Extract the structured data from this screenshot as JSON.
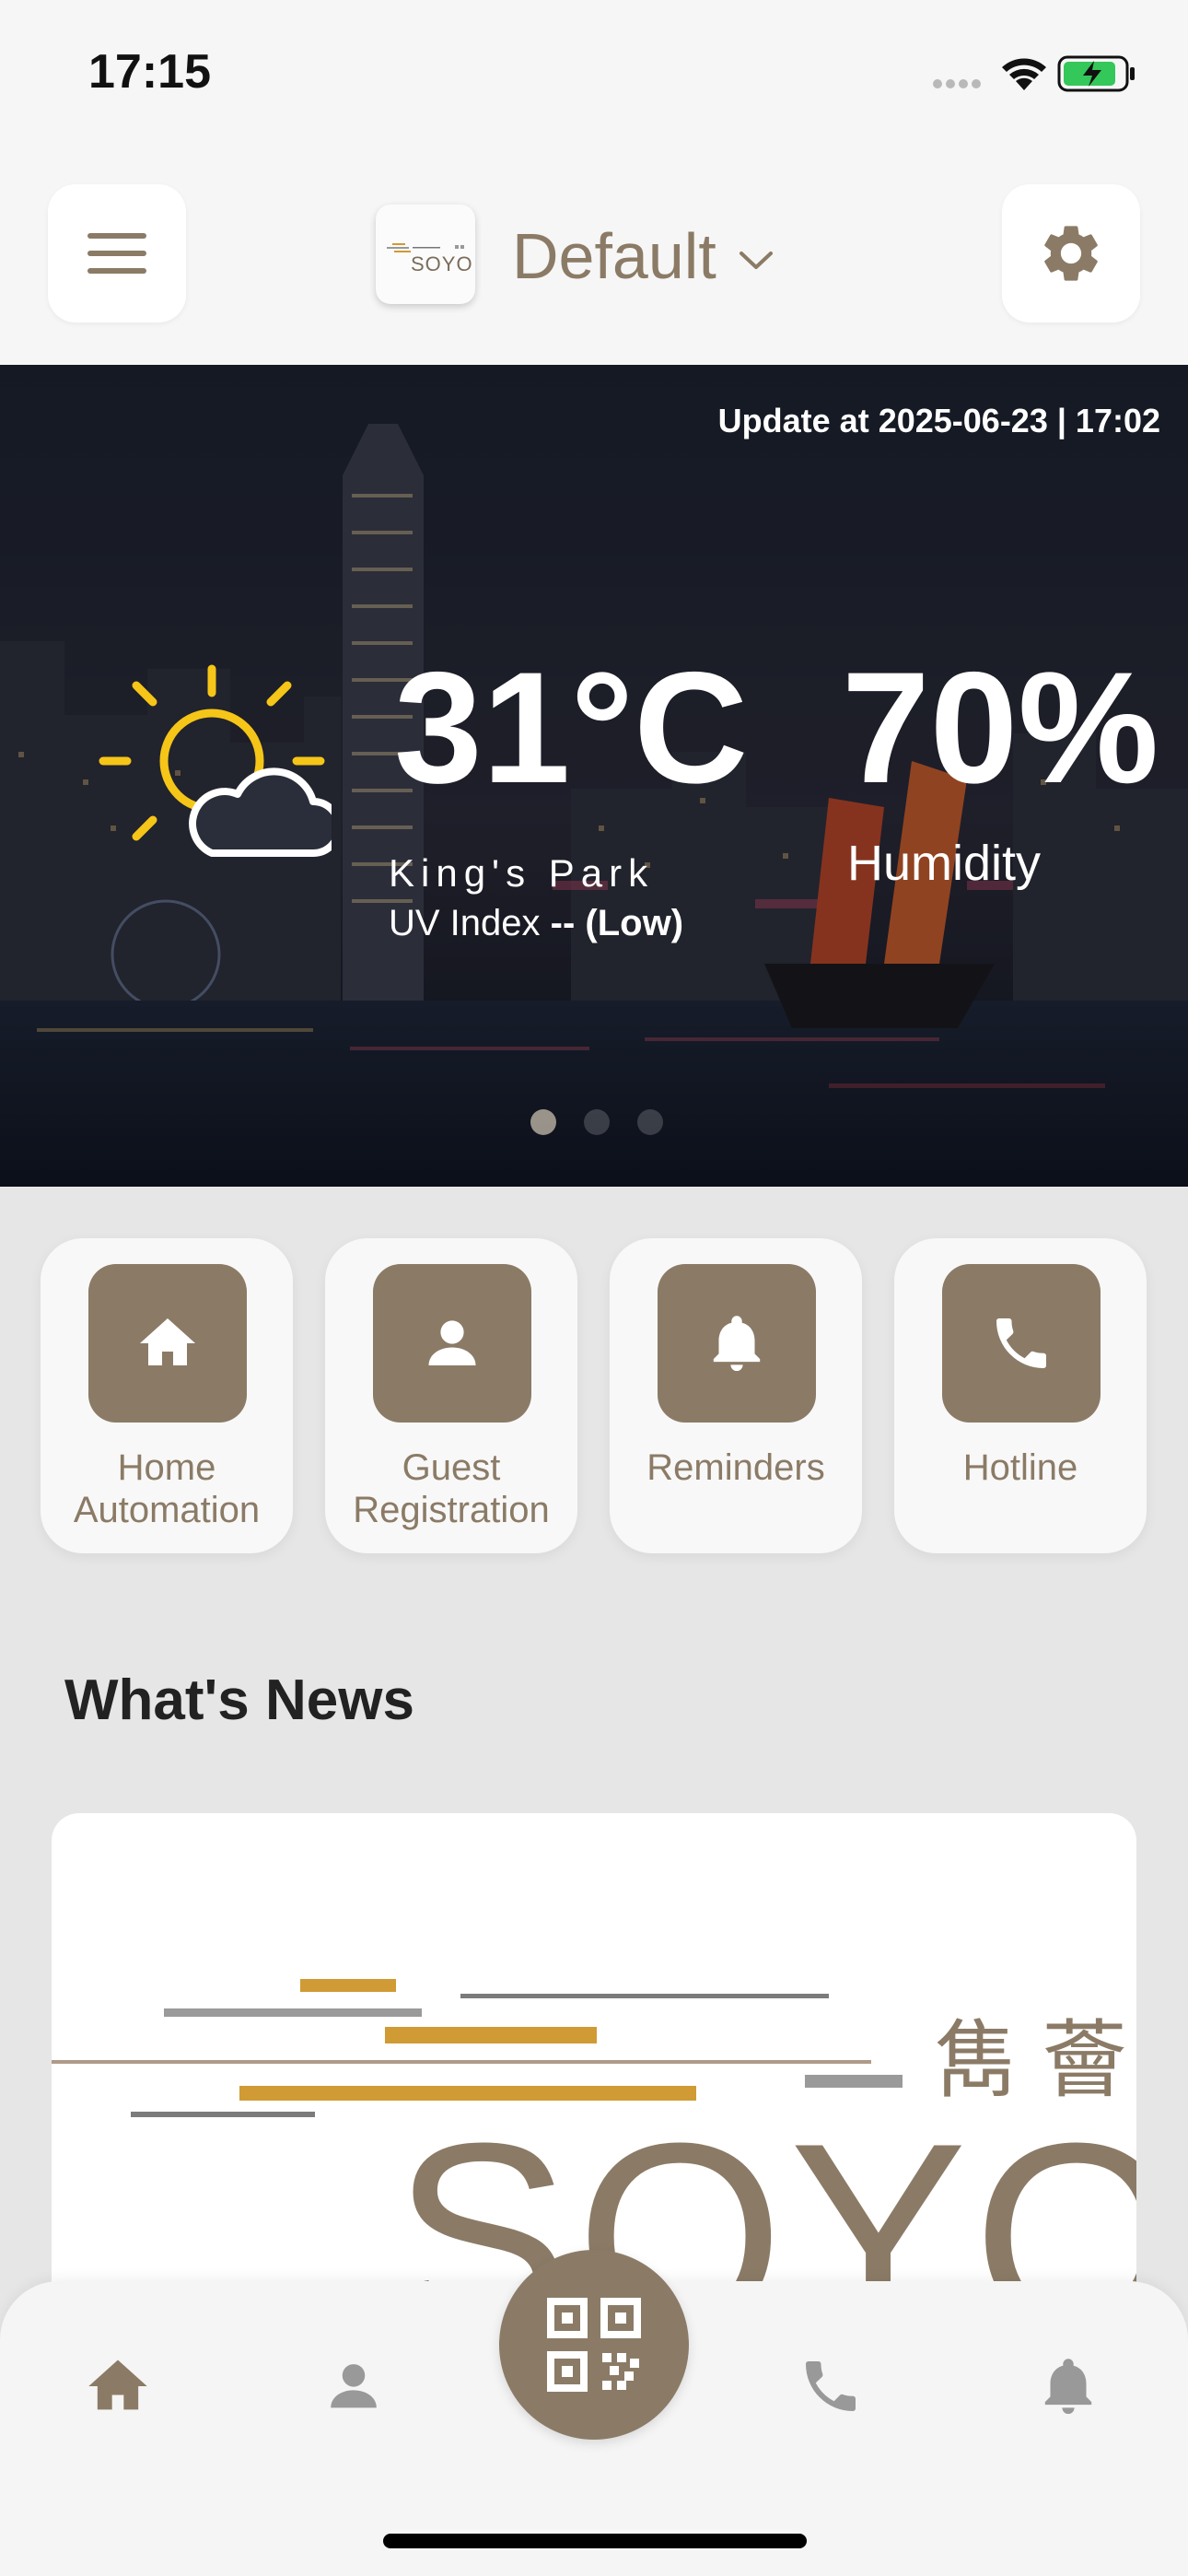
{
  "status_bar": {
    "time": "17:15"
  },
  "header": {
    "menu_icon": "hamburger-menu-icon",
    "logo_text": "SOYO",
    "home_name": "Default",
    "settings_icon": "gear-icon"
  },
  "weather": {
    "update_text": "Update at 2025-06-23 | 17:02",
    "temperature": "31°C",
    "location": "King's Park",
    "uv_label": "UV Index",
    "uv_value": "-- (Low)",
    "humidity_value": "70%",
    "humidity_label": "Humidity",
    "icon": "partly-sunny-icon",
    "slide_count": 3,
    "active_slide": 1
  },
  "quick_actions": [
    {
      "line1": "Home",
      "line2": "Automation",
      "icon": "home-icon"
    },
    {
      "line1": "Guest",
      "line2": "Registration",
      "icon": "person-icon"
    },
    {
      "line1": "Reminders",
      "line2": "",
      "icon": "bell-icon"
    },
    {
      "line1": "Hotline",
      "line2": "",
      "icon": "phone-icon"
    }
  ],
  "news": {
    "section_title": "What's News",
    "brand_text": "SOYO",
    "brand_chinese": "雋 薈"
  },
  "bottom_nav": {
    "items": [
      "home-icon",
      "person-icon",
      "qr-code-icon",
      "phone-icon",
      "bell-icon"
    ],
    "active": "home-icon"
  },
  "colors": {
    "brand": "#8b7b66",
    "accent_gold": "#d09a35",
    "background": "#e6e6e6"
  }
}
